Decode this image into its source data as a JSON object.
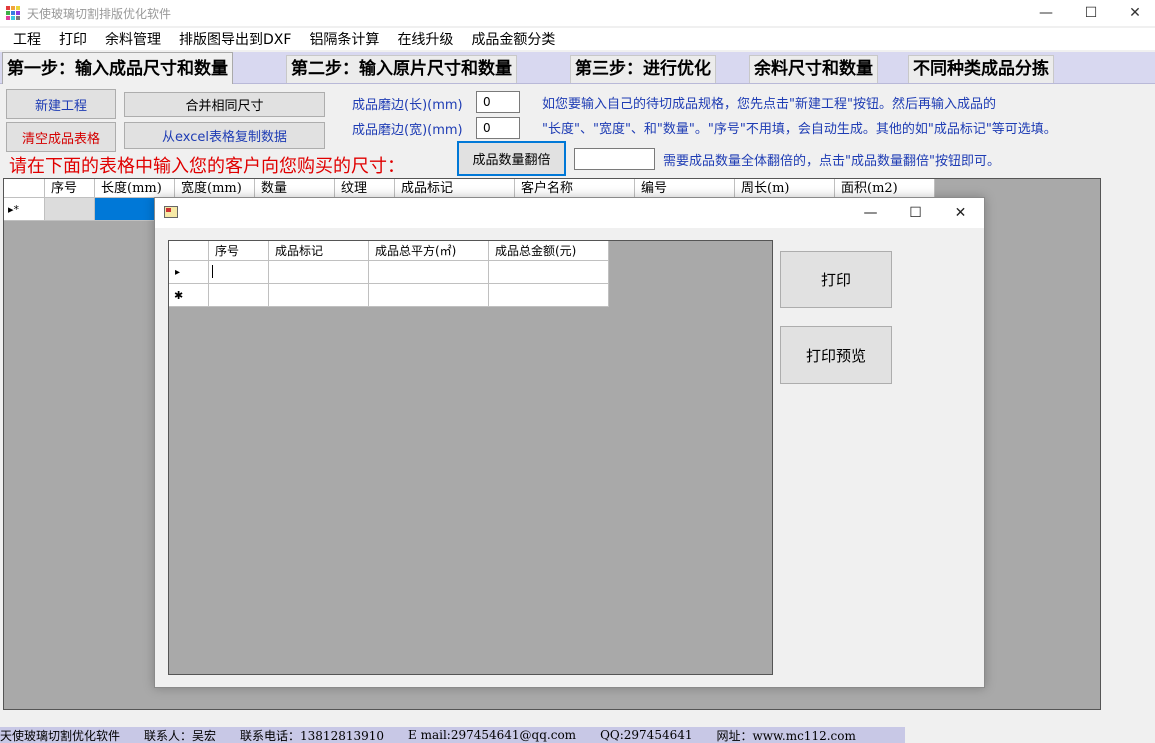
{
  "window": {
    "title": "天使玻璃切割排版优化软件",
    "minimize_glyph": "—",
    "maximize_glyph": "☐",
    "close_glyph": "✕"
  },
  "menu": [
    "工程",
    "打印",
    "余料管理",
    "排版图导出到DXF",
    "铝隔条计算",
    "在线升级",
    "成品金额分类"
  ],
  "tabs": [
    "第一步：输入成品尺寸和数量",
    "第二步：输入原片尺寸和数量",
    "第三步：进行优化",
    "余料尺寸和数量",
    "不同种类成品分拣"
  ],
  "toolbar": {
    "new_project": "新建工程",
    "merge_sizes": "合并相同尺寸",
    "clear_table": "清空成品表格",
    "copy_from_excel": "从excel表格复制数据",
    "edge_length_label": "成品磨边(长)(mm)",
    "edge_length_value": "0",
    "edge_width_label": "成品磨边(宽)(mm)",
    "edge_width_value": "0",
    "help_line1": "如您要输入自己的待切成品规格，您先点击\"新建工程\"按钮。然后再输入成品的",
    "help_line2": "\"长度\"、\"宽度\"、和\"数量\"。\"序号\"不用填，会自动生成。其他的如\"成品标记\"等可选填。",
    "instruction": "请在下面的表格中输入您的客户向您购买的尺寸：",
    "double_qty_button": "成品数量翻倍",
    "double_qty_value": "",
    "double_qty_hint": "需要成品数量全体翻倍的，点击\"成品数量翻倍\"按钮即可。"
  },
  "main_grid": {
    "columns": [
      "序号",
      "长度(mm)",
      "宽度(mm)",
      "数量",
      "纹理",
      "成品标记",
      "客户名称",
      "编号",
      "周长(m)",
      "面积(m2)"
    ],
    "new_row_marker": "▸*"
  },
  "dialog": {
    "title": "",
    "minimize_glyph": "—",
    "maximize_glyph": "☐",
    "close_glyph": "✕",
    "columns": [
      "序号",
      "成品标记",
      "成品总平方(㎡)",
      "成品总金额(元)"
    ],
    "current_row_marker": "▸",
    "new_row_marker": "✱",
    "print_button": "打印",
    "print_preview_button": "打印预览"
  },
  "status": {
    "app_name": "天使玻璃切割优化软件",
    "contact": "联系人：吴宏",
    "phone": "联系电话：13812813910",
    "email": "E mail:297454641@qq.com",
    "qq": "QQ:297454641",
    "website": "网址：www.mc112.com"
  },
  "colors": {
    "accent_blue": "#0078d7",
    "red_text": "#e00000",
    "blue_text": "#1e3cb4",
    "tab_strip": "#d8d8f0",
    "grid_bg": "#a9a9a9"
  }
}
